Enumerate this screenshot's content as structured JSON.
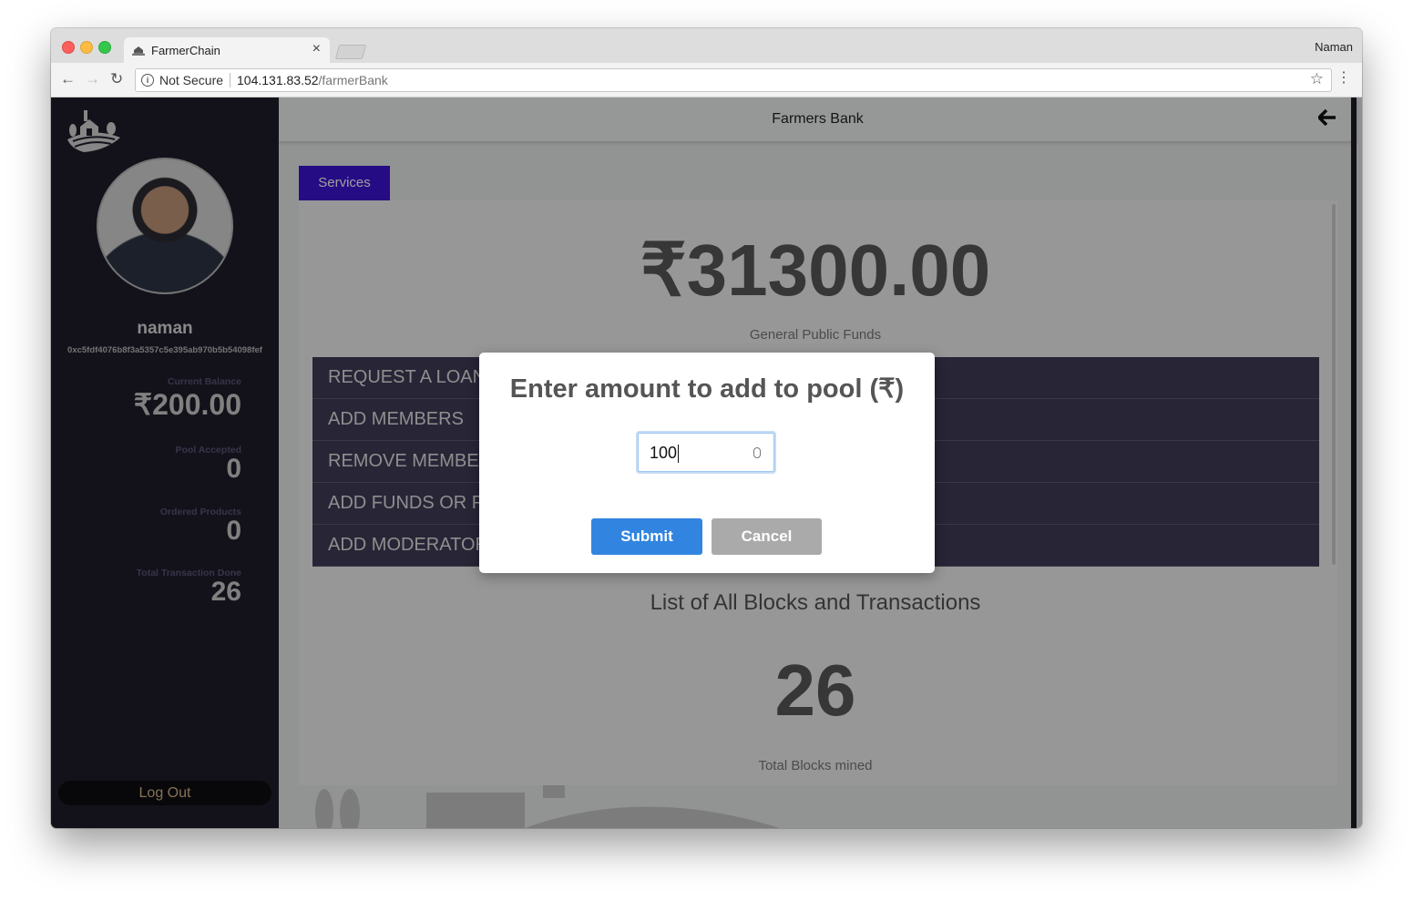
{
  "browser": {
    "tab_title": "FarmerChain",
    "tab_close": "×",
    "profile_name": "Naman",
    "security_label": "Not Secure",
    "url_host": "104.131.83.52",
    "url_path": "/farmerBank",
    "back_glyph": "←",
    "forward_glyph": "→",
    "reload_glyph": "↻",
    "star_glyph": "☆",
    "menu_glyph": "⋮",
    "info_glyph": "i"
  },
  "sidebar": {
    "username": "naman",
    "address": "0xc5fdf4076b8f3a5357c5e395ab970b5b54098fef",
    "stats": [
      {
        "label": "Current Balance",
        "value": "₹200.00"
      },
      {
        "label": "Pool Accepted",
        "value": "0"
      },
      {
        "label": "Ordered Products",
        "value": "0"
      },
      {
        "label": "Total Transaction Done",
        "value": "26"
      }
    ],
    "logout_label": "Log Out"
  },
  "header": {
    "title": "Farmers Bank",
    "back_glyph": "🡸"
  },
  "main": {
    "services_tab": "Services",
    "funds_amount": "₹31300.00",
    "funds_label": "General Public Funds",
    "services": [
      "REQUEST A LOAN",
      "ADD MEMBERS",
      "REMOVE MEMBERS",
      "ADD FUNDS OR PAY",
      "ADD MODERATOR"
    ],
    "blocks_title": "List of All Blocks and Transactions",
    "blocks_count": "26",
    "blocks_label": "Total Blocks mined"
  },
  "modal": {
    "title": "Enter amount to add to pool (₹)",
    "input_value": "100",
    "submit_label": "Submit",
    "cancel_label": "Cancel"
  },
  "colors": {
    "sidebar_bg": "#1f1e2c",
    "services_tab_bg": "#3e14d6",
    "submit_bg": "#3185e0",
    "cancel_bg": "#aaaaaa"
  }
}
